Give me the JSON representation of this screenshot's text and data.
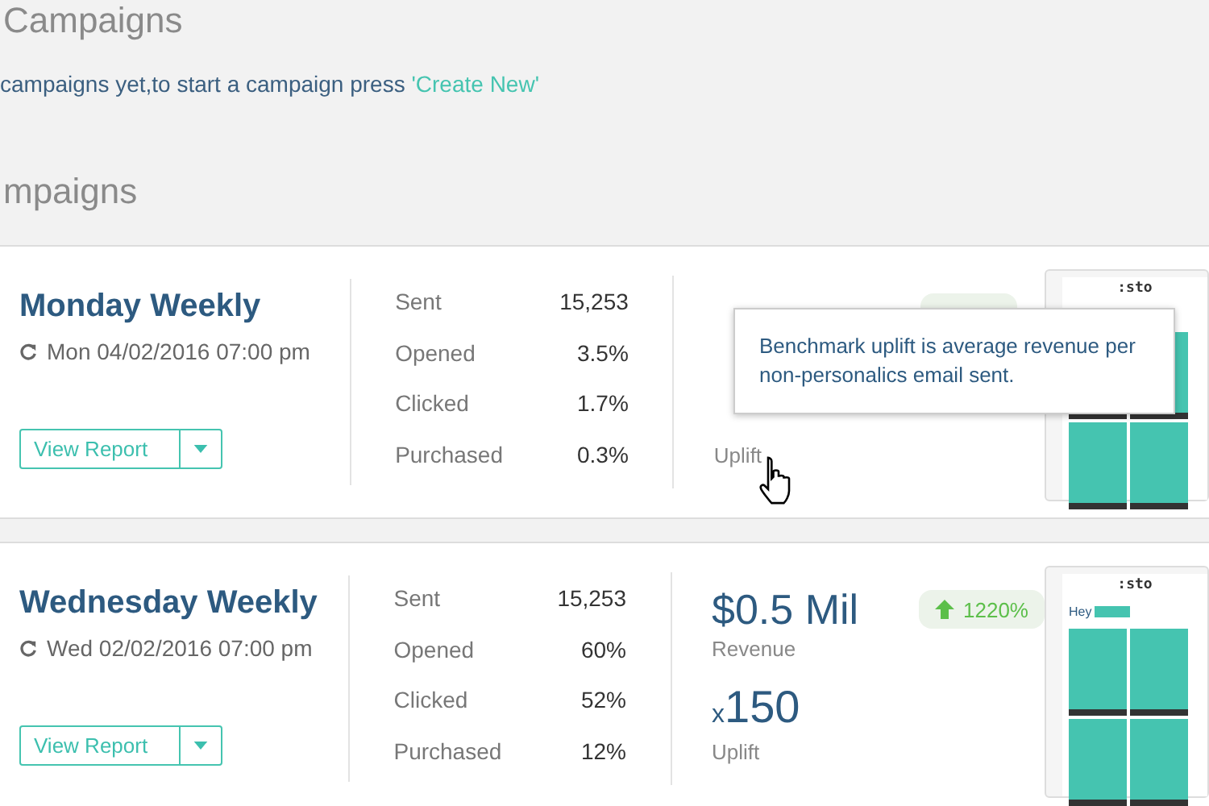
{
  "sections": [
    {
      "heading": "Campaigns",
      "message": "campaigns yet,to start a campaign press",
      "link": "'Create New'"
    },
    {
      "heading": "mpaigns"
    }
  ],
  "campaigns": [
    {
      "name": "Monday Weekly",
      "schedule": "Mon 04/02/2016 07:00 pm",
      "button": "View Report",
      "stats": [
        {
          "label": "Sent",
          "value": "15,253"
        },
        {
          "label": "Opened",
          "value": "3.5%"
        },
        {
          "label": "Clicked",
          "value": "1.7%"
        },
        {
          "label": "Purchased",
          "value": "0.3%"
        }
      ],
      "uplift_label": "Uplift",
      "badge_visible": true,
      "tooltip": "Benchmark uplift is average revenue per non-personalics email sent.",
      "preview": {
        "brand": ":sto"
      }
    },
    {
      "name": "Wednesday Weekly",
      "schedule": "Wed 02/02/2016 07:00 pm",
      "button": "View Report",
      "stats": [
        {
          "label": "Sent",
          "value": "15,253"
        },
        {
          "label": "Opened",
          "value": "60%"
        },
        {
          "label": "Clicked",
          "value": "52%"
        },
        {
          "label": "Purchased",
          "value": "12%"
        }
      ],
      "revenue": "$0.5 Mil",
      "revenue_label": "Revenue",
      "badge": "1220%",
      "uplift": "x150",
      "uplift_label": "Uplift",
      "preview": {
        "brand": ":sto",
        "greeting": "Hey"
      }
    }
  ]
}
